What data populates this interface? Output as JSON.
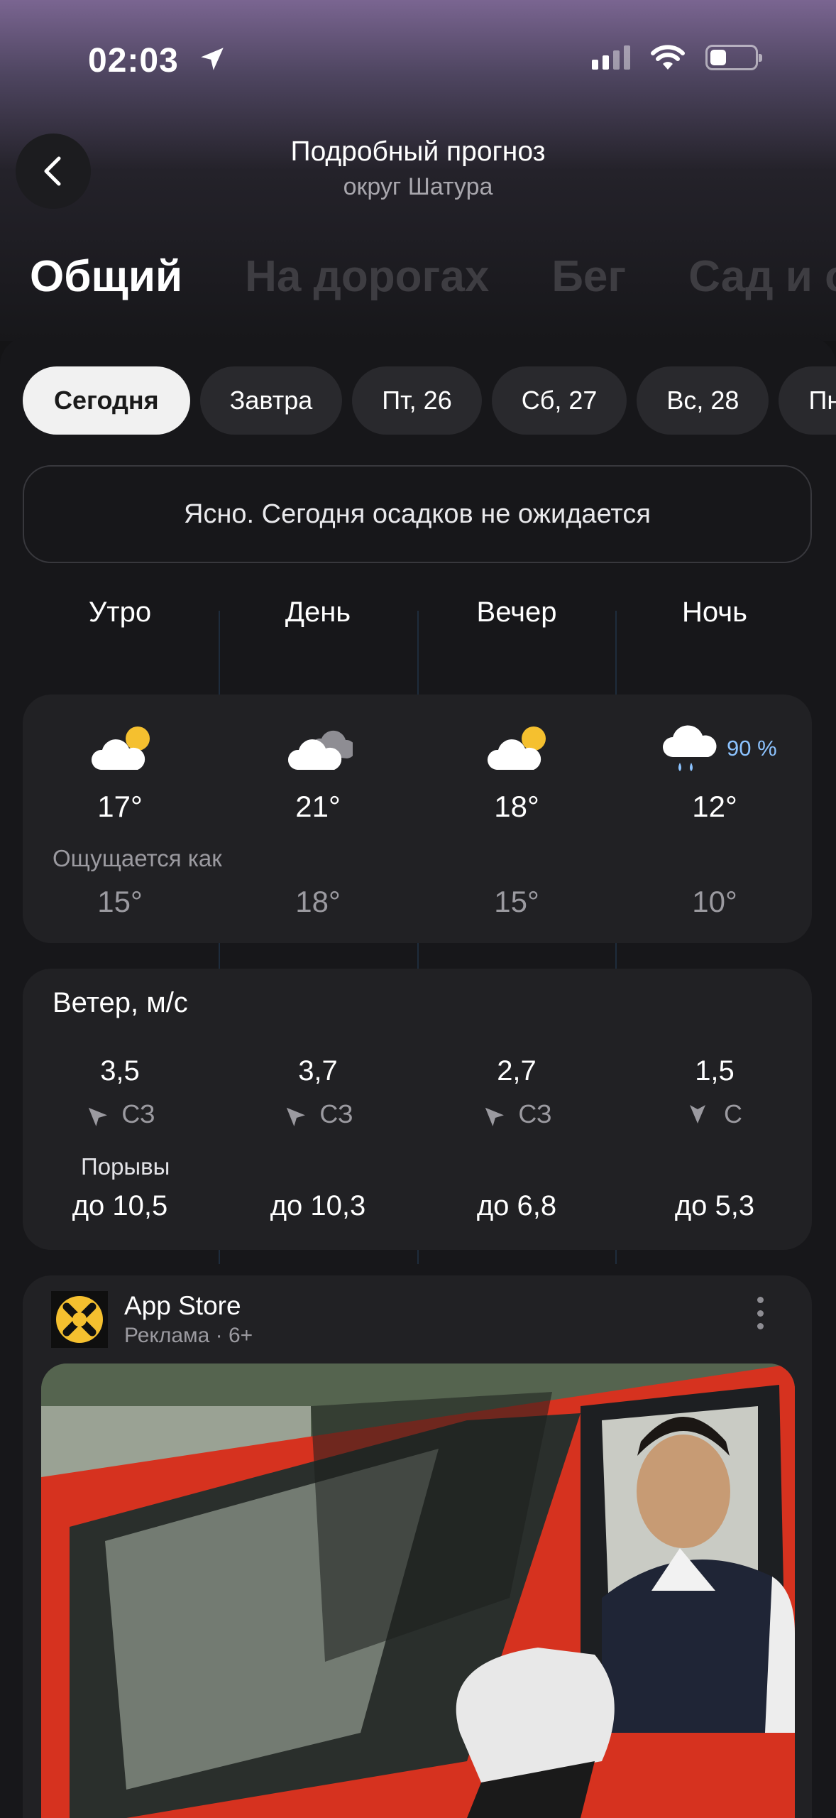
{
  "status_bar": {
    "time": "02:03"
  },
  "header": {
    "title": "Подробный прогноз",
    "subtitle": "округ Шатура"
  },
  "tabs": [
    {
      "label": "Общий",
      "active": true
    },
    {
      "label": "На дорогах"
    },
    {
      "label": "Бег"
    },
    {
      "label": "Сад и о"
    }
  ],
  "day_chips": [
    {
      "label": "Сегодня",
      "active": true
    },
    {
      "label": "Завтра"
    },
    {
      "label": "Пт, 26"
    },
    {
      "label": "Сб, 27"
    },
    {
      "label": "Вс, 28"
    },
    {
      "label": "Пн"
    }
  ],
  "summary": "Ясно. Сегодня осадков не ожидается",
  "periods": [
    {
      "name": "Утро",
      "icon": "partly-cloudy-sun-icon",
      "temp": "17°",
      "feels": "15°",
      "wind_speed": "3,5",
      "wind_dir": "СЗ",
      "gust": "до 10,5"
    },
    {
      "name": "День",
      "icon": "cloudy-icon",
      "temp": "21°",
      "feels": "18°",
      "wind_speed": "3,7",
      "wind_dir": "СЗ",
      "gust": "до 10,3"
    },
    {
      "name": "Вечер",
      "icon": "partly-cloudy-sun-icon",
      "temp": "18°",
      "feels": "15°",
      "wind_speed": "2,7",
      "wind_dir": "СЗ",
      "gust": "до 6,8"
    },
    {
      "name": "Ночь",
      "icon": "rain-icon",
      "temp": "12°",
      "feels": "10°",
      "wind_speed": "1,5",
      "wind_dir": "С",
      "gust": "до 5,3",
      "precip": "90 %"
    }
  ],
  "feels_label": "Ощущается как",
  "wind": {
    "title": "Ветер, м/с",
    "gust_label": "Порывы"
  },
  "ad": {
    "title": "App Store",
    "meta": "Реклама · 6+"
  },
  "colors": {
    "accent_sun": "#f5c02f",
    "precip": "#8cc3ff",
    "ad_car": "#e0331f"
  }
}
